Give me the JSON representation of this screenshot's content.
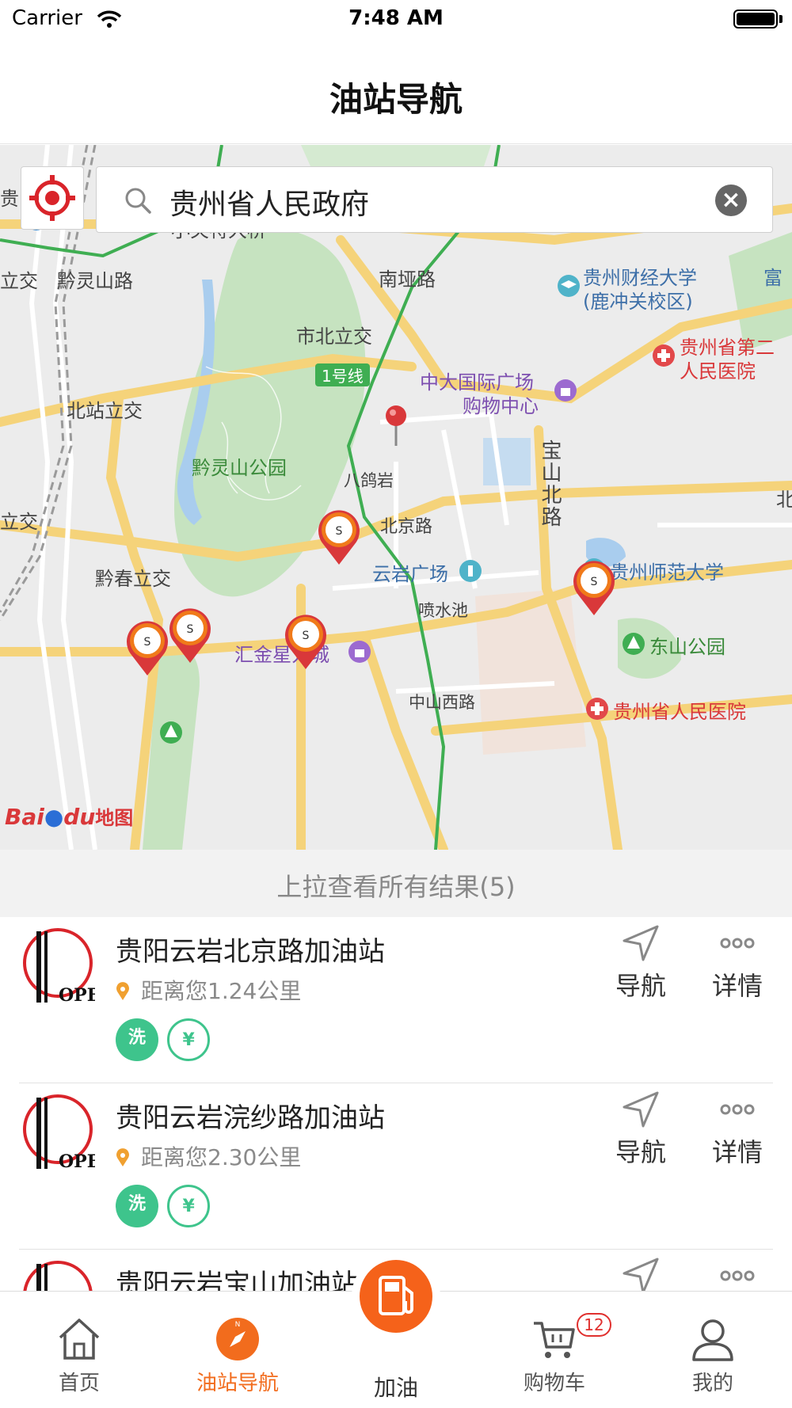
{
  "status": {
    "carrier": "Carrier",
    "time": "7:48 AM"
  },
  "nav": {
    "title": "油站导航"
  },
  "search": {
    "value": "贵州省人民政府"
  },
  "map": {
    "labels": {
      "bridge": "小关特大桥",
      "qianling_road": "黔灵山路",
      "nanya_road": "南垭路",
      "shibei": "市北立交",
      "line1": "1号线",
      "univ_finance": "贵州财经大学",
      "univ_finance_sub": "(鹿冲关校区)",
      "hospital2_a": "贵州省第二",
      "hospital2_b": "人民医院",
      "zhongda_a": "中大国际广场",
      "zhongda_b": "购物中心",
      "beizhan": "北站立交",
      "qianling_park": "黔灵山公园",
      "bageyan": "八鸽岩",
      "baoshan": "宝山北路",
      "beijing_road": "北京路",
      "yunyan_square": "云岩广场",
      "normal_univ": "贵州师范大学",
      "qianchun": "黔春立交",
      "penshuichi": "喷水池",
      "dongshan_park": "东山公园",
      "huijin": "汇金星力城",
      "zhongshan_west": "中山西路",
      "prov_hospital": "贵州省人民医院",
      "left_edge1": "立交",
      "left_edge2": "立交",
      "right_edge1": "富",
      "right_edge2": "北",
      "left_top": "贵",
      "baidu": "Bai",
      "baidu_du": "du",
      "baidu_map": "地图"
    }
  },
  "pull_up": {
    "text": "上拉查看所有结果(5)"
  },
  "stations": [
    {
      "name": "贵阳云岩北京路加油站",
      "distance": "距离您1.24公里",
      "nav_label": "导航",
      "detail_label": "详情"
    },
    {
      "name": "贵阳云岩浣纱路加油站",
      "distance": "距离您2.30公里",
      "nav_label": "导航",
      "detail_label": "详情"
    },
    {
      "name": "贵阳云岩宝山加油站",
      "distance": "",
      "nav_label": "导航",
      "detail_label": "详情"
    }
  ],
  "tab_bar": {
    "home": "首页",
    "station_nav": "油站导航",
    "refuel": "加油",
    "cart": "购物车",
    "cart_badge": "12",
    "mine": "我的"
  },
  "colors": {
    "accent": "#f26c1d",
    "green": "#3ec48c",
    "pin_red": "#d9383a"
  }
}
